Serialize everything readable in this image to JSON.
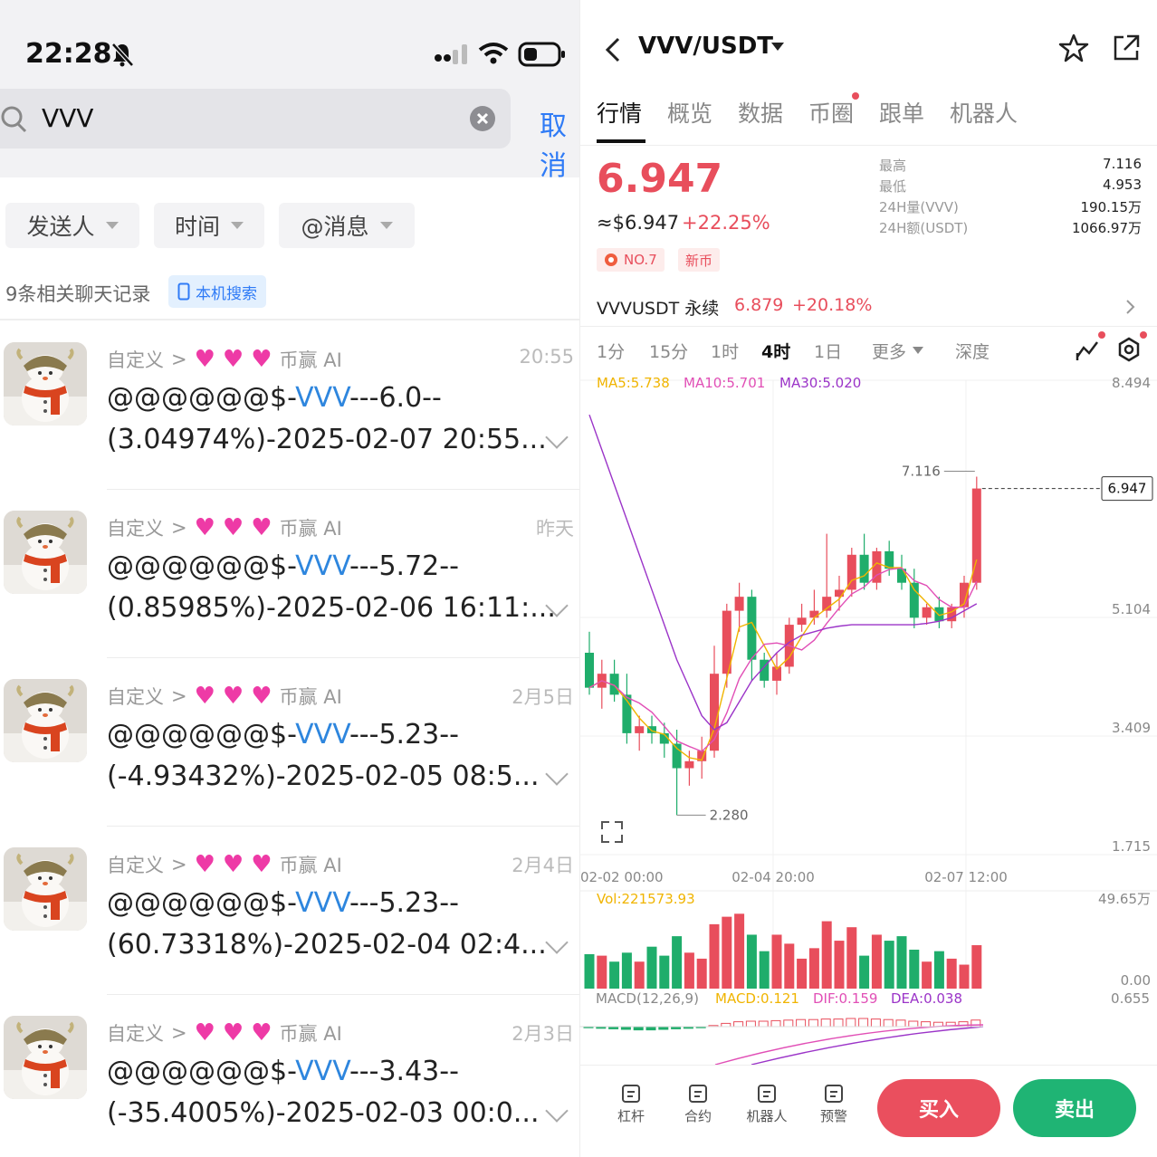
{
  "left": {
    "status_time": "22:28",
    "search_value": "VVV",
    "cancel_label": "取消",
    "filters": [
      "发送人",
      "时间",
      "@消息"
    ],
    "result_count": "9条相关聊天记录",
    "local_search": "本机搜索",
    "messages": [
      {
        "sender": "自定义",
        "source": "币赢 AI",
        "time": "20:55",
        "prefix": "@@@@@@$-",
        "symbol": "VVV",
        "suffix": "---6.0--",
        "line2": "(3.04974%)-2025-02-07 20:55..."
      },
      {
        "sender": "自定义",
        "source": "币赢 AI",
        "time": "昨天",
        "prefix": "@@@@@@$-",
        "symbol": "VVV",
        "suffix": "---5.72--",
        "line2": "(0.85985%)-2025-02-06 16:11:..."
      },
      {
        "sender": "自定义",
        "source": "币赢 AI",
        "time": "2月5日",
        "prefix": "@@@@@@$-",
        "symbol": "VVV",
        "suffix": "---5.23--",
        "line2": "(-4.93432%)-2025-02-05 08:5..."
      },
      {
        "sender": "自定义",
        "source": "币赢 AI",
        "time": "2月4日",
        "prefix": "@@@@@@$-",
        "symbol": "VVV",
        "suffix": "---5.23--",
        "line2": "(60.73318%)-2025-02-04 02:4..."
      },
      {
        "sender": "自定义",
        "source": "币赢 AI",
        "time": "2月3日",
        "prefix": "@@@@@@$-",
        "symbol": "VVV",
        "suffix": "---3.43--",
        "line2": "(-35.4005%)-2025-02-03 00:0..."
      }
    ]
  },
  "right": {
    "pair": "VVV/USDT",
    "tabs": [
      "行情",
      "概览",
      "数据",
      "币圈",
      "跟单",
      "机器人"
    ],
    "price": "6.947",
    "price_usd": "≈$6.947",
    "change": "+22.25%",
    "badge_rank": "NO.7",
    "badge_new": "新币",
    "stats": [
      {
        "label": "最高",
        "value": "7.116"
      },
      {
        "label": "最低",
        "value": "4.953"
      },
      {
        "label": "24H量(VVV)",
        "value": "190.15万"
      },
      {
        "label": "24H额(USDT)",
        "value": "1066.97万"
      }
    ],
    "perp_name": "VVVUSDT 永续",
    "perp_price": "6.879",
    "perp_change": "+20.18%",
    "timeframes": [
      "1分",
      "15分",
      "1时",
      "4时",
      "1日",
      "更多",
      "深度"
    ],
    "ma5": "MA5:5.738",
    "ma10": "MA10:5.701",
    "ma30": "MA30:5.020",
    "y_ticks": [
      "8.494",
      "5.104",
      "3.409",
      "1.715"
    ],
    "x_ticks": [
      "02-02 00:00",
      "02-04 20:00",
      "02-07 12:00"
    ],
    "high_label": "7.116",
    "low_label": "2.280",
    "current_label": "6.947",
    "vol_label": "Vol:221573.93",
    "vol_max": "49.65万",
    "vol_min": "0.00",
    "macd_label": "MACD(12,26,9)",
    "macd_val": "MACD:0.121",
    "dif_val": "DIF:0.159",
    "dea_val": "DEA:0.038",
    "macd_max": "0.655",
    "bottom_items": [
      "杠杆",
      "合约",
      "机器人",
      "预警"
    ],
    "buy_label": "买入",
    "sell_label": "卖出",
    "colors": {
      "up": "#e84e5c",
      "down": "#1fad6b",
      "ma5": "#f0b400",
      "ma10": "#e14fb6",
      "ma30": "#9b34c8"
    }
  },
  "chart_data": {
    "type": "candlestick",
    "ylim": [
      1.715,
      8.494
    ],
    "candles": [
      {
        "o": 4.6,
        "h": 4.9,
        "l": 4.0,
        "c": 4.1
      },
      {
        "o": 4.1,
        "h": 4.5,
        "l": 3.8,
        "c": 4.3
      },
      {
        "o": 4.3,
        "h": 4.5,
        "l": 3.9,
        "c": 4.0
      },
      {
        "o": 4.0,
        "h": 4.3,
        "l": 3.3,
        "c": 3.45
      },
      {
        "o": 3.45,
        "h": 3.7,
        "l": 3.2,
        "c": 3.55
      },
      {
        "o": 3.55,
        "h": 3.7,
        "l": 3.3,
        "c": 3.45
      },
      {
        "o": 3.45,
        "h": 3.6,
        "l": 3.1,
        "c": 3.3
      },
      {
        "o": 3.3,
        "h": 3.5,
        "l": 2.28,
        "c": 2.95
      },
      {
        "o": 2.95,
        "h": 3.2,
        "l": 2.7,
        "c": 3.05
      },
      {
        "o": 3.05,
        "h": 3.4,
        "l": 2.8,
        "c": 3.2
      },
      {
        "o": 3.2,
        "h": 4.7,
        "l": 3.1,
        "c": 4.3
      },
      {
        "o": 4.3,
        "h": 5.3,
        "l": 4.1,
        "c": 5.2
      },
      {
        "o": 5.2,
        "h": 5.6,
        "l": 4.9,
        "c": 5.4
      },
      {
        "o": 5.4,
        "h": 5.5,
        "l": 4.2,
        "c": 4.5
      },
      {
        "o": 4.5,
        "h": 4.6,
        "l": 4.1,
        "c": 4.2
      },
      {
        "o": 4.2,
        "h": 4.6,
        "l": 4.0,
        "c": 4.4
      },
      {
        "o": 4.4,
        "h": 5.1,
        "l": 4.3,
        "c": 5.0
      },
      {
        "o": 5.0,
        "h": 5.3,
        "l": 4.9,
        "c": 5.1
      },
      {
        "o": 5.1,
        "h": 5.5,
        "l": 5.0,
        "c": 5.2
      },
      {
        "o": 5.2,
        "h": 6.3,
        "l": 5.1,
        "c": 5.4
      },
      {
        "o": 5.4,
        "h": 5.7,
        "l": 5.2,
        "c": 5.5
      },
      {
        "o": 5.5,
        "h": 6.1,
        "l": 5.4,
        "c": 6.0
      },
      {
        "o": 6.0,
        "h": 6.3,
        "l": 5.5,
        "c": 5.6
      },
      {
        "o": 5.6,
        "h": 6.1,
        "l": 5.5,
        "c": 6.05
      },
      {
        "o": 6.05,
        "h": 6.2,
        "l": 5.7,
        "c": 5.8
      },
      {
        "o": 5.8,
        "h": 6.0,
        "l": 5.5,
        "c": 5.6
      },
      {
        "o": 5.6,
        "h": 5.8,
        "l": 4.95,
        "c": 5.1
      },
      {
        "o": 5.1,
        "h": 5.3,
        "l": 5.0,
        "c": 5.25
      },
      {
        "o": 5.25,
        "h": 5.4,
        "l": 4.95,
        "c": 5.05
      },
      {
        "o": 5.05,
        "h": 5.3,
        "l": 4.95,
        "c": 5.25
      },
      {
        "o": 5.25,
        "h": 5.7,
        "l": 5.1,
        "c": 5.6
      },
      {
        "o": 5.6,
        "h": 7.116,
        "l": 5.5,
        "c": 6.947
      }
    ],
    "volume": [
      2.3,
      2.2,
      1.8,
      2.4,
      1.8,
      2.8,
      2.2,
      3.5,
      2.4,
      2.0,
      4.3,
      4.8,
      5.0,
      3.6,
      2.5,
      3.6,
      3.0,
      2.0,
      2.7,
      4.5,
      3.2,
      4.1,
      2.2,
      3.6,
      3.2,
      3.5,
      2.6,
      1.8,
      2.5,
      2.0,
      1.6,
      2.9
    ],
    "macd_hist": [
      -0.02,
      -0.03,
      -0.04,
      -0.05,
      -0.06,
      -0.06,
      -0.05,
      -0.04,
      -0.03,
      -0.02,
      0.02,
      0.06,
      0.09,
      0.1,
      0.1,
      0.11,
      0.12,
      0.13,
      0.13,
      0.14,
      0.14,
      0.15,
      0.15,
      0.14,
      0.13,
      0.12,
      0.1,
      0.09,
      0.08,
      0.08,
      0.09,
      0.121
    ]
  }
}
